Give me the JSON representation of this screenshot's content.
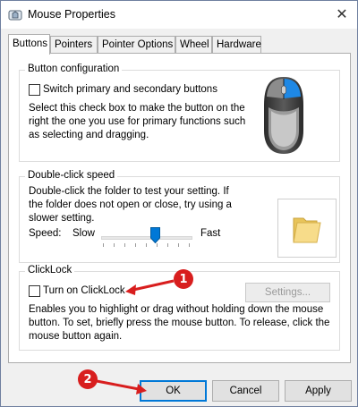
{
  "window": {
    "title": "Mouse Properties",
    "icon": "mouse-icon",
    "close_glyph": "✕"
  },
  "tabs": [
    {
      "label": "Buttons",
      "active": true
    },
    {
      "label": "Pointers",
      "active": false
    },
    {
      "label": "Pointer Options",
      "active": false
    },
    {
      "label": "Wheel",
      "active": false
    },
    {
      "label": "Hardware",
      "active": false
    }
  ],
  "button_configuration": {
    "legend": "Button configuration",
    "checkbox_label": "Switch primary and secondary buttons",
    "checked": false,
    "description": "Select this check box to make the button on the right the one you use for primary functions such as selecting and dragging.",
    "image": "mouse-image"
  },
  "double_click": {
    "legend": "Double-click speed",
    "description": "Double-click the folder to test your setting. If the folder does not open or close, try using a slower setting.",
    "speed_label": "Speed:",
    "slow_label": "Slow",
    "fast_label": "Fast",
    "speed_value": 0.6,
    "test_icon": "folder-icon"
  },
  "clicklock": {
    "legend": "ClickLock",
    "checkbox_label": "Turn on ClickLock",
    "checked": false,
    "settings_button": "Settings...",
    "settings_enabled": false,
    "description": "Enables you to highlight or drag without holding down the mouse button. To set, briefly press the mouse button. To release, click the mouse button again."
  },
  "footer": {
    "ok": "OK",
    "cancel": "Cancel",
    "apply": "Apply"
  },
  "annotations": {
    "callout_1": "1",
    "callout_2": "2",
    "color": "#d81e1e"
  },
  "colors": {
    "accent": "#0078d7",
    "mouse_highlight": "#1e88e5"
  }
}
